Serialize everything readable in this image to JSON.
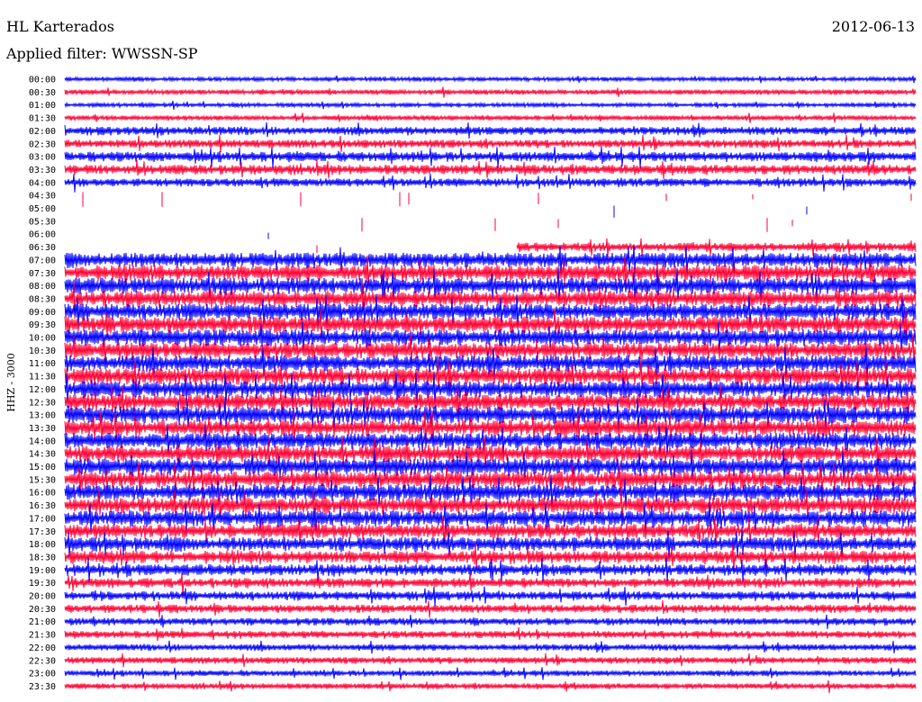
{
  "header": {
    "station": "HL Karterados",
    "date": "2012-06-13",
    "filter": "Applied filter: WWSSN-SP"
  },
  "chart_data": {
    "type": "line",
    "title": "HL Karterados",
    "subtitle": "Applied filter: WWSSN-SP",
    "ylabel": "HHZ - 3000",
    "xlabel": "",
    "legend": "none",
    "grid": false,
    "colors": [
      "#0000ff",
      "#ff0033"
    ],
    "rows": [
      {
        "label": "00:00",
        "amp": 0.25,
        "gap": [
          0.0,
          0.0
        ]
      },
      {
        "label": "00:30",
        "amp": 0.3,
        "gap": [
          0.0,
          0.0
        ]
      },
      {
        "label": "01:00",
        "amp": 0.25,
        "gap": [
          0.0,
          0.0
        ]
      },
      {
        "label": "01:30",
        "amp": 0.3,
        "gap": [
          0.0,
          0.0
        ]
      },
      {
        "label": "02:00",
        "amp": 0.5,
        "gap": [
          0.0,
          0.0
        ]
      },
      {
        "label": "02:30",
        "amp": 0.5,
        "gap": [
          0.0,
          0.0
        ]
      },
      {
        "label": "03:00",
        "amp": 0.6,
        "gap": [
          0.0,
          0.0
        ]
      },
      {
        "label": "03:30",
        "amp": 0.6,
        "gap": [
          0.0,
          0.0
        ]
      },
      {
        "label": "04:00",
        "amp": 0.5,
        "gap": [
          0.0,
          0.0
        ]
      },
      {
        "label": "04:30",
        "amp": 0.0,
        "gap": [
          0.0,
          1.0
        ]
      },
      {
        "label": "05:00",
        "amp": 0.0,
        "gap": [
          0.0,
          1.0
        ]
      },
      {
        "label": "05:30",
        "amp": 0.0,
        "gap": [
          0.0,
          1.0
        ]
      },
      {
        "label": "06:00",
        "amp": 0.0,
        "gap": [
          0.0,
          1.0
        ]
      },
      {
        "label": "06:30",
        "amp": 0.55,
        "gap": [
          0.0,
          0.53
        ]
      },
      {
        "label": "07:00",
        "amp": 0.9,
        "gap": [
          0.0,
          0.0
        ]
      },
      {
        "label": "07:30",
        "amp": 1.0,
        "gap": [
          0.0,
          0.0
        ]
      },
      {
        "label": "08:00",
        "amp": 1.0,
        "gap": [
          0.0,
          0.0
        ]
      },
      {
        "label": "08:30",
        "amp": 1.0,
        "gap": [
          0.0,
          0.0
        ]
      },
      {
        "label": "09:00",
        "amp": 1.0,
        "gap": [
          0.0,
          0.0
        ]
      },
      {
        "label": "09:30",
        "amp": 1.0,
        "gap": [
          0.0,
          0.0
        ]
      },
      {
        "label": "10:00",
        "amp": 1.0,
        "gap": [
          0.0,
          0.0
        ]
      },
      {
        "label": "10:30",
        "amp": 1.0,
        "gap": [
          0.0,
          0.0
        ]
      },
      {
        "label": "11:00",
        "amp": 1.0,
        "gap": [
          0.0,
          0.0
        ]
      },
      {
        "label": "11:30",
        "amp": 1.0,
        "gap": [
          0.0,
          0.0
        ]
      },
      {
        "label": "12:00",
        "amp": 1.0,
        "gap": [
          0.0,
          0.0
        ]
      },
      {
        "label": "12:30",
        "amp": 1.0,
        "gap": [
          0.0,
          0.0
        ]
      },
      {
        "label": "13:00",
        "amp": 1.0,
        "gap": [
          0.0,
          0.0
        ]
      },
      {
        "label": "13:30",
        "amp": 1.0,
        "gap": [
          0.0,
          0.0
        ]
      },
      {
        "label": "14:00",
        "amp": 1.0,
        "gap": [
          0.0,
          0.0
        ]
      },
      {
        "label": "14:30",
        "amp": 1.0,
        "gap": [
          0.0,
          0.0
        ]
      },
      {
        "label": "15:00",
        "amp": 1.0,
        "gap": [
          0.0,
          0.0
        ]
      },
      {
        "label": "15:30",
        "amp": 1.0,
        "gap": [
          0.0,
          0.0
        ]
      },
      {
        "label": "16:00",
        "amp": 1.0,
        "gap": [
          0.0,
          0.0
        ]
      },
      {
        "label": "16:30",
        "amp": 1.0,
        "gap": [
          0.0,
          0.0
        ]
      },
      {
        "label": "17:00",
        "amp": 0.95,
        "gap": [
          0.0,
          0.0
        ]
      },
      {
        "label": "17:30",
        "amp": 0.9,
        "gap": [
          0.0,
          0.0
        ]
      },
      {
        "label": "18:00",
        "amp": 0.85,
        "gap": [
          0.0,
          0.0
        ]
      },
      {
        "label": "18:30",
        "amp": 0.8,
        "gap": [
          0.0,
          0.0
        ]
      },
      {
        "label": "19:00",
        "amp": 0.7,
        "gap": [
          0.0,
          0.0
        ]
      },
      {
        "label": "19:30",
        "amp": 0.6,
        "gap": [
          0.0,
          0.0
        ]
      },
      {
        "label": "20:00",
        "amp": 0.55,
        "gap": [
          0.0,
          0.0
        ]
      },
      {
        "label": "20:30",
        "amp": 0.5,
        "gap": [
          0.0,
          0.0
        ]
      },
      {
        "label": "21:00",
        "amp": 0.45,
        "gap": [
          0.0,
          0.0
        ]
      },
      {
        "label": "21:30",
        "amp": 0.45,
        "gap": [
          0.0,
          0.0
        ]
      },
      {
        "label": "22:00",
        "amp": 0.4,
        "gap": [
          0.0,
          0.0
        ]
      },
      {
        "label": "22:30",
        "amp": 0.4,
        "gap": [
          0.0,
          0.0
        ]
      },
      {
        "label": "23:00",
        "amp": 0.35,
        "gap": [
          0.0,
          0.0
        ]
      },
      {
        "label": "23:30",
        "amp": 0.35,
        "gap": [
          0.0,
          0.0
        ]
      }
    ]
  }
}
